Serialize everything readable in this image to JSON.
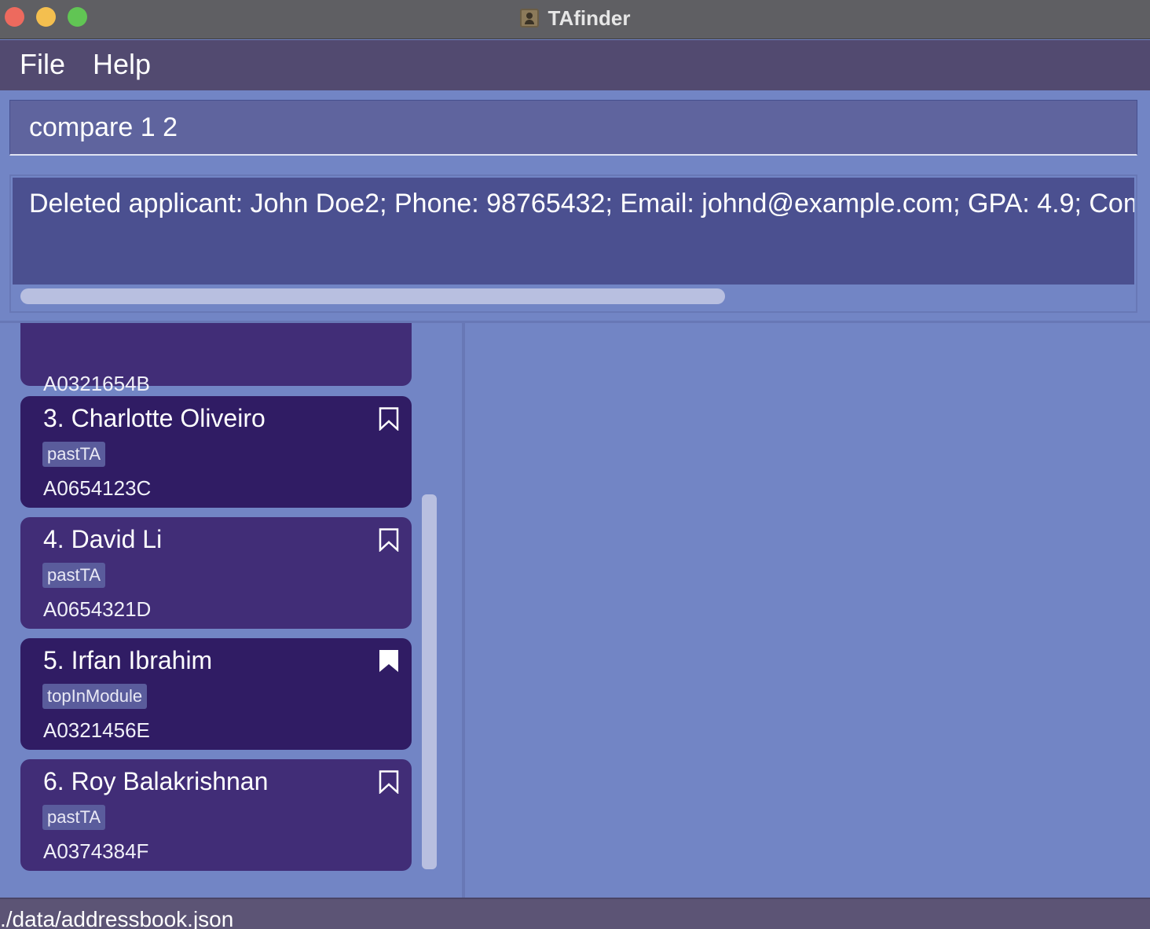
{
  "window": {
    "title": "TAfinder"
  },
  "menu": {
    "file": "File",
    "help": "Help"
  },
  "command": {
    "value": "compare 1 2"
  },
  "result": {
    "text": "Deleted applicant: John Doe2; Phone: 98765432; Email: johnd@example.com; GPA: 4.9; Comments: "
  },
  "applicants": [
    {
      "index": "",
      "name": "",
      "tag": "",
      "id": "A0321654B",
      "bookmarked": false
    },
    {
      "index": "3.",
      "name": "Charlotte Oliveiro",
      "tag": "pastTA",
      "id": "A0654123C",
      "bookmarked": false
    },
    {
      "index": "4.",
      "name": "David Li",
      "tag": "pastTA",
      "id": "A0654321D",
      "bookmarked": false
    },
    {
      "index": "5.",
      "name": "Irfan Ibrahim",
      "tag": "topInModule",
      "id": "A0321456E",
      "bookmarked": true
    },
    {
      "index": "6.",
      "name": "Roy Balakrishnan",
      "tag": "pastTA",
      "id": "A0374384F",
      "bookmarked": false
    }
  ],
  "applicant_display": [
    {
      "name_line": ""
    },
    {
      "name_line": "3.  Charlotte Oliveiro"
    },
    {
      "name_line": "4.  David Li"
    },
    {
      "name_line": "5.  Irfan Ibrahim"
    },
    {
      "name_line": "6.  Roy Balakrishnan"
    }
  ],
  "status": {
    "path": "./data/addressbook.json"
  }
}
